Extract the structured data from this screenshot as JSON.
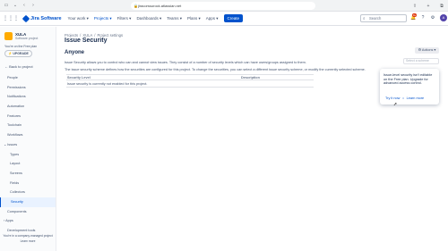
{
  "browser": {
    "url": "jiracorssurock.atlassian.net",
    "left_icons": [
      "sidebar-icon",
      "tab-icon",
      "back-icon",
      "forward-icon",
      "reload-icon"
    ],
    "right_icons": [
      "share-icon",
      "add-tab-icon",
      "tabs-icon"
    ]
  },
  "app": {
    "brand": "Jira Software",
    "nav": [
      "Your work ▾",
      "Projects ▾",
      "Filters ▾",
      "Dashboards ▾",
      "Teams ▾",
      "Plans ▾",
      "Apps ▾"
    ],
    "create_label": "Create",
    "search_placeholder": "Search",
    "notification_count": "9+",
    "user_initials": "A"
  },
  "sidebar": {
    "project_name": "XULA",
    "project_type": "Software project",
    "free_plan_text": "You're on the Free plan",
    "upgrade_label": "UPGRADE",
    "back_label": "Back to project",
    "items": [
      {
        "label": "People"
      },
      {
        "label": "Permissions"
      },
      {
        "label": "Notifications"
      },
      {
        "label": "Automation"
      },
      {
        "label": "Features"
      },
      {
        "label": "Toolchain"
      },
      {
        "label": "Workflows"
      },
      {
        "label": "⌄ Issues"
      },
      {
        "label": "Types"
      },
      {
        "label": "Layout"
      },
      {
        "label": "Screens"
      },
      {
        "label": "Fields"
      },
      {
        "label": "Collectors"
      },
      {
        "label": "Security"
      },
      {
        "label": "Components"
      },
      {
        "label": "› Apps"
      },
      {
        "label": "Development tools"
      }
    ],
    "footer_text": "You're in a company-managed project",
    "footer_link": "Learn more"
  },
  "main": {
    "breadcrumbs": [
      "Projects",
      "/",
      "XULA",
      "/",
      "Project settings"
    ],
    "title": "Issue Security",
    "subtitle": "Anyone",
    "actions_label": "Actions ▾",
    "select_scheme": "Select a scheme",
    "description": "Issue Security allows you to control who can and cannot view issues. They consist of a number of security levels which can have users/groups assigned to them.",
    "description2": "The issue security scheme defines how the securities are configured for this project. To change the securities, you can select a different issue security scheme, or modify the currently selected scheme.",
    "table_headers": [
      "Security Level",
      "Description"
    ],
    "table_empty": "Issue security is currently not enabled for this project."
  },
  "popup": {
    "text": "Issue-level security isn't editable on the Free plan. Upgrade for advanced access control.",
    "try_label": "Try it now",
    "learn_label": "Learn more"
  }
}
